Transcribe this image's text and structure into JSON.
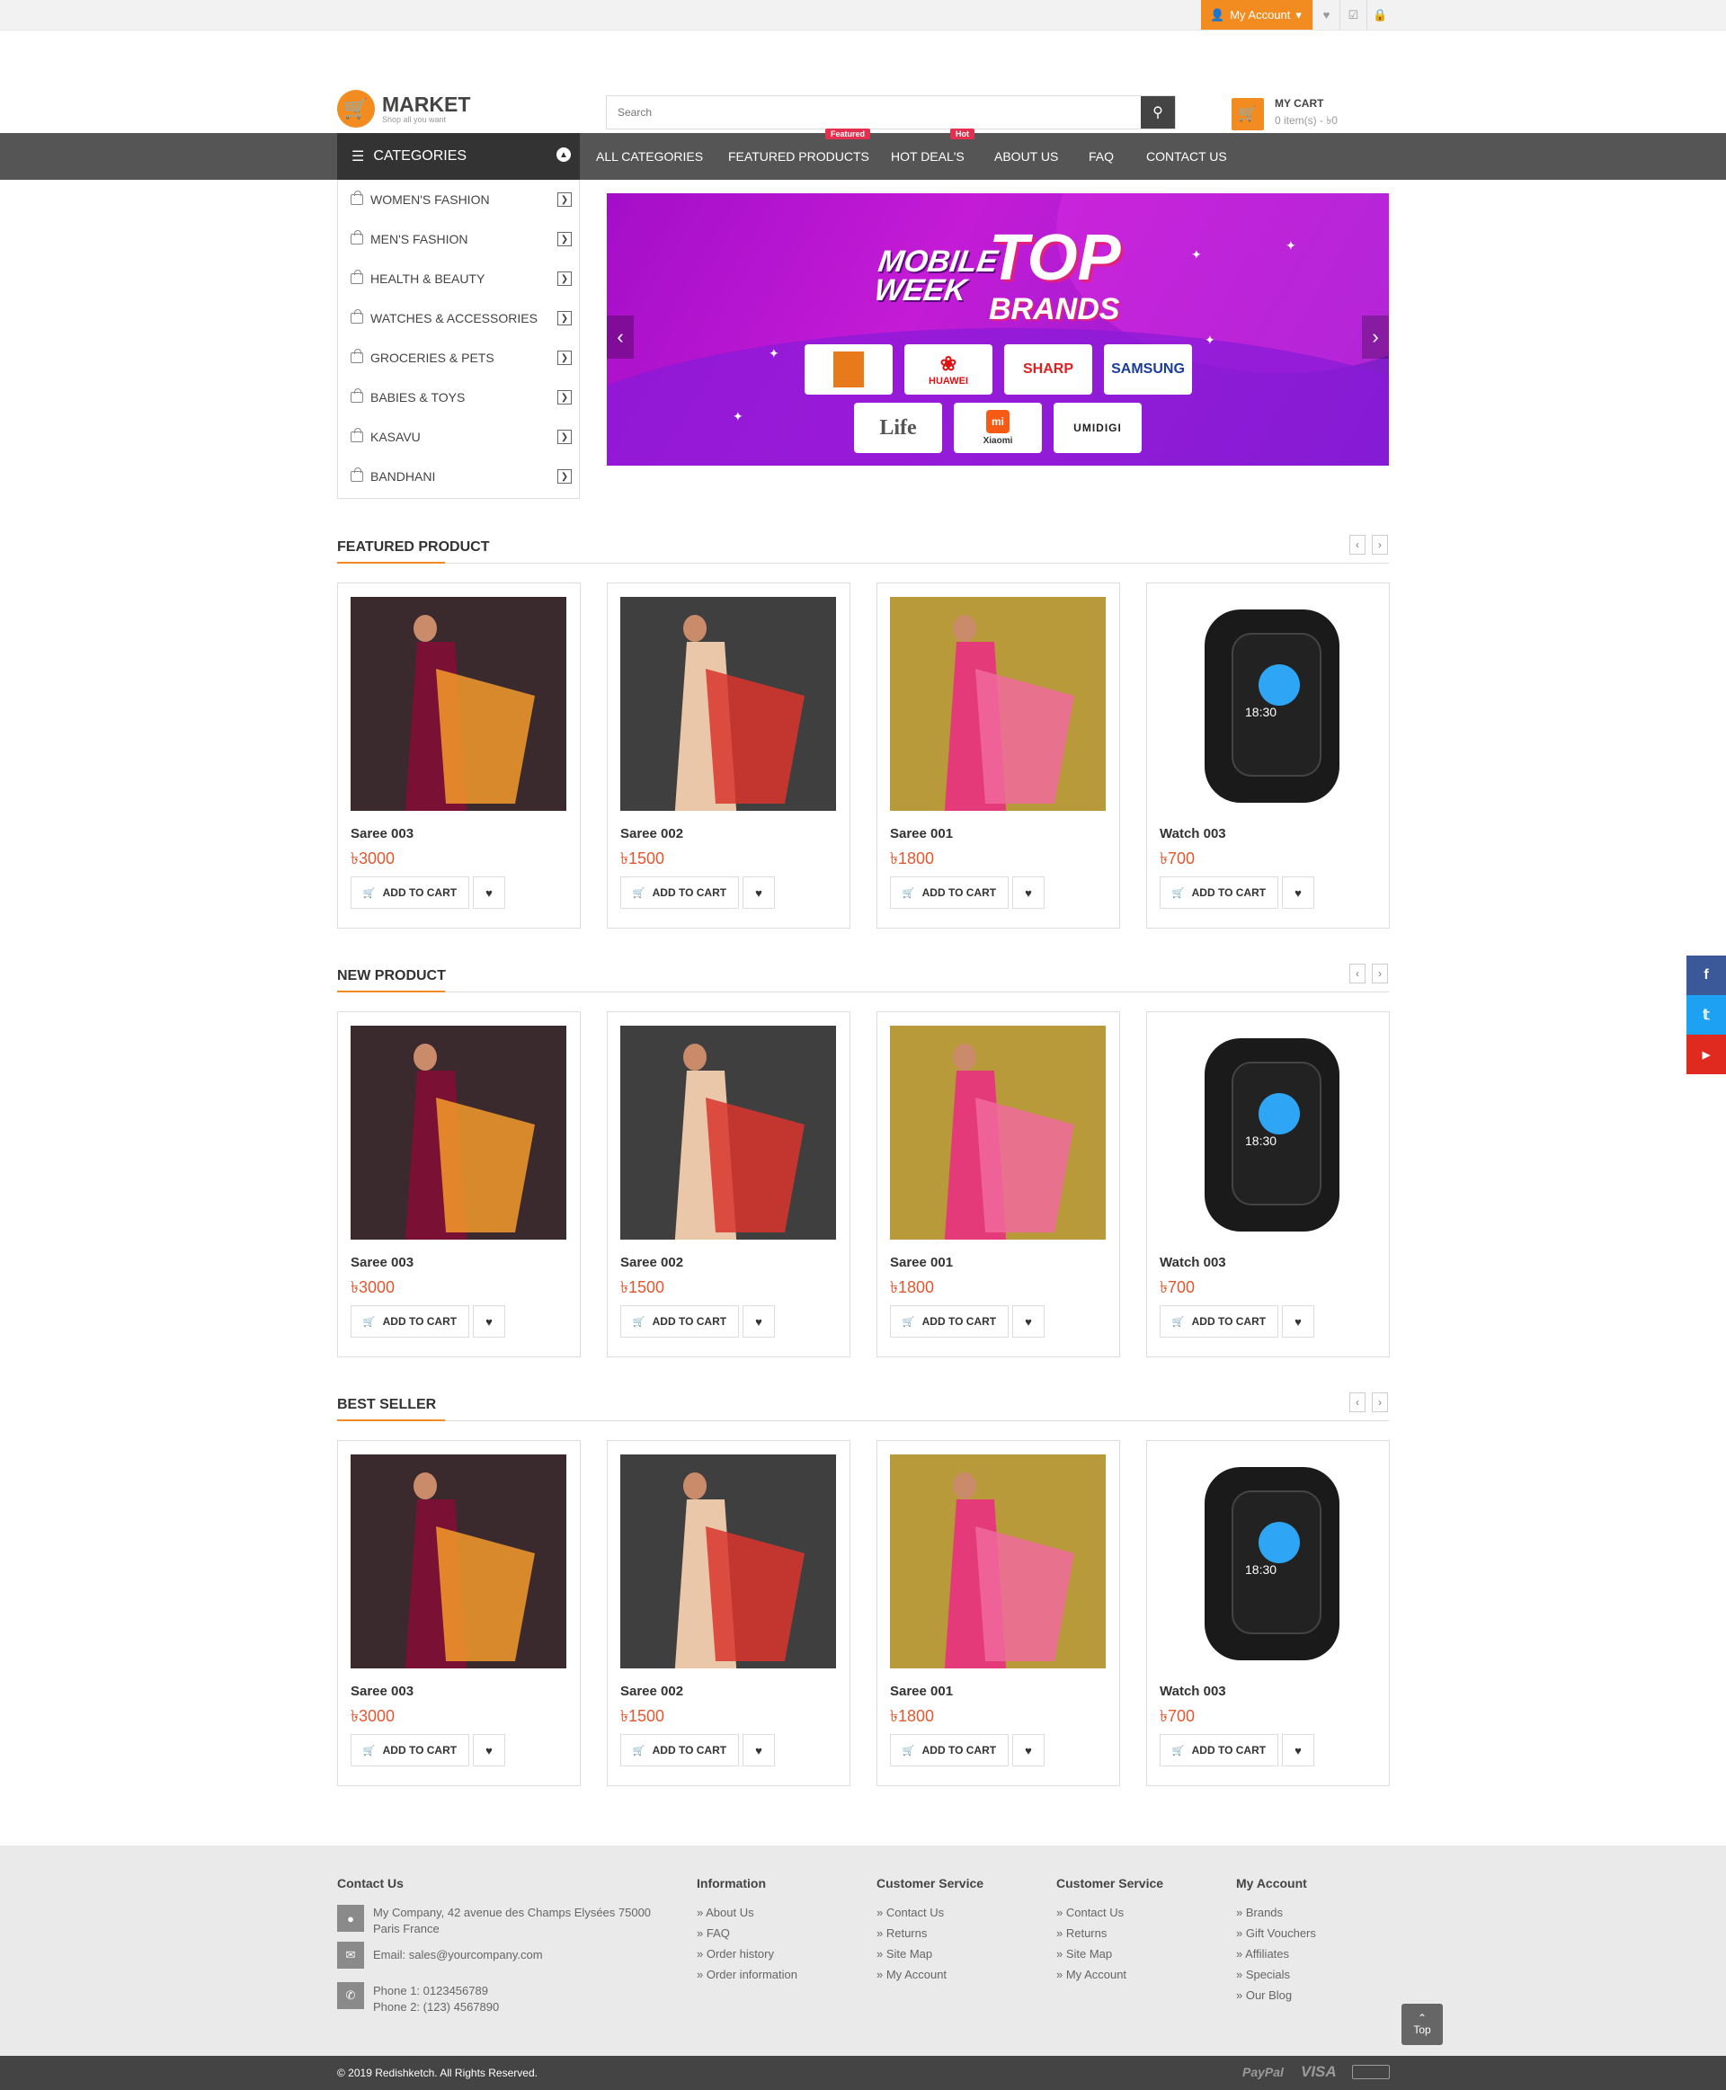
{
  "topbar": {
    "account": "My Account",
    "icons": [
      "heart-icon",
      "checkout-icon",
      "lock-icon"
    ]
  },
  "header": {
    "logo_name": "MARKET",
    "logo_tag": "Shop all you want",
    "search_placeholder": "Search",
    "cart_title": "MY CART",
    "cart_summary": "0 item(s) - ৳0"
  },
  "nav": {
    "categories_label": "CATEGORIES",
    "menu": [
      "ALL CATEGORIES",
      "FEATURED PRODUCTS",
      "HOT DEAL'S",
      "ABOUT US",
      "FAQ",
      "CONTACT US"
    ],
    "tag_featured": "Featured",
    "tag_hot": "Hot"
  },
  "sidebar": [
    "WOMEN'S FASHION",
    "MEN'S FASHION",
    "HEALTH & BEAUTY",
    "WATCHES & ACCESSORIES",
    "GROCERIES & PETS",
    "BABIES & TOYS",
    "KASAVU",
    "BANDHANI"
  ],
  "banner": {
    "line1": "MOBILE",
    "line2": "WEEK",
    "top": "TOP",
    "brands_label": "BRANDS",
    "brands": [
      "SHARP",
      "SAMSUNG",
      "Life",
      "Xiaomi",
      "UMIDIGI",
      "HUAWEI"
    ]
  },
  "sections": [
    {
      "title": "FEATURED PRODUCT"
    },
    {
      "title": "NEW PRODUCT"
    },
    {
      "title": "BEST SELLER"
    }
  ],
  "products": [
    {
      "name": "Saree 003",
      "price": "৳3000"
    },
    {
      "name": "Saree 002",
      "price": "৳1500"
    },
    {
      "name": "Saree 001",
      "price": "৳1800"
    },
    {
      "name": "Watch 003",
      "price": "৳700"
    }
  ],
  "card_actions": {
    "add_to_cart": "ADD TO CART"
  },
  "watch_time": "18:30",
  "social": [
    "f",
    "t",
    "yt"
  ],
  "footer": {
    "contact_title": "Contact Us",
    "address": "My Company, 42 avenue des Champs Elysées 75000 Paris France",
    "email": "Email: sales@yourcompany.com",
    "phone1": "Phone 1: 0123456789",
    "phone2": "Phone 2: (123) 4567890",
    "columns": [
      {
        "title": "Information",
        "links": [
          "About Us",
          "FAQ",
          "Order history",
          "Order information"
        ]
      },
      {
        "title": "Customer Service",
        "links": [
          "Contact Us",
          "Returns",
          "Site Map",
          "My Account"
        ]
      },
      {
        "title": "Customer Service",
        "links": [
          "Contact Us",
          "Returns",
          "Site Map",
          "My Account"
        ]
      },
      {
        "title": "My Account",
        "links": [
          "Brands",
          "Gift Vouchers",
          "Affiliates",
          "Specials",
          "Our Blog"
        ]
      }
    ],
    "top_label": "Top",
    "copyright": "© 2019 Redishketch. All Rights Reserved.",
    "payments": [
      "PayPal",
      "VISA"
    ]
  },
  "colors": {
    "accent": "#f28c20",
    "nav": "#555555",
    "price": "#e4572e",
    "facebook": "#3b5998",
    "twitter": "#1da1f2",
    "youtube": "#e02a20"
  }
}
